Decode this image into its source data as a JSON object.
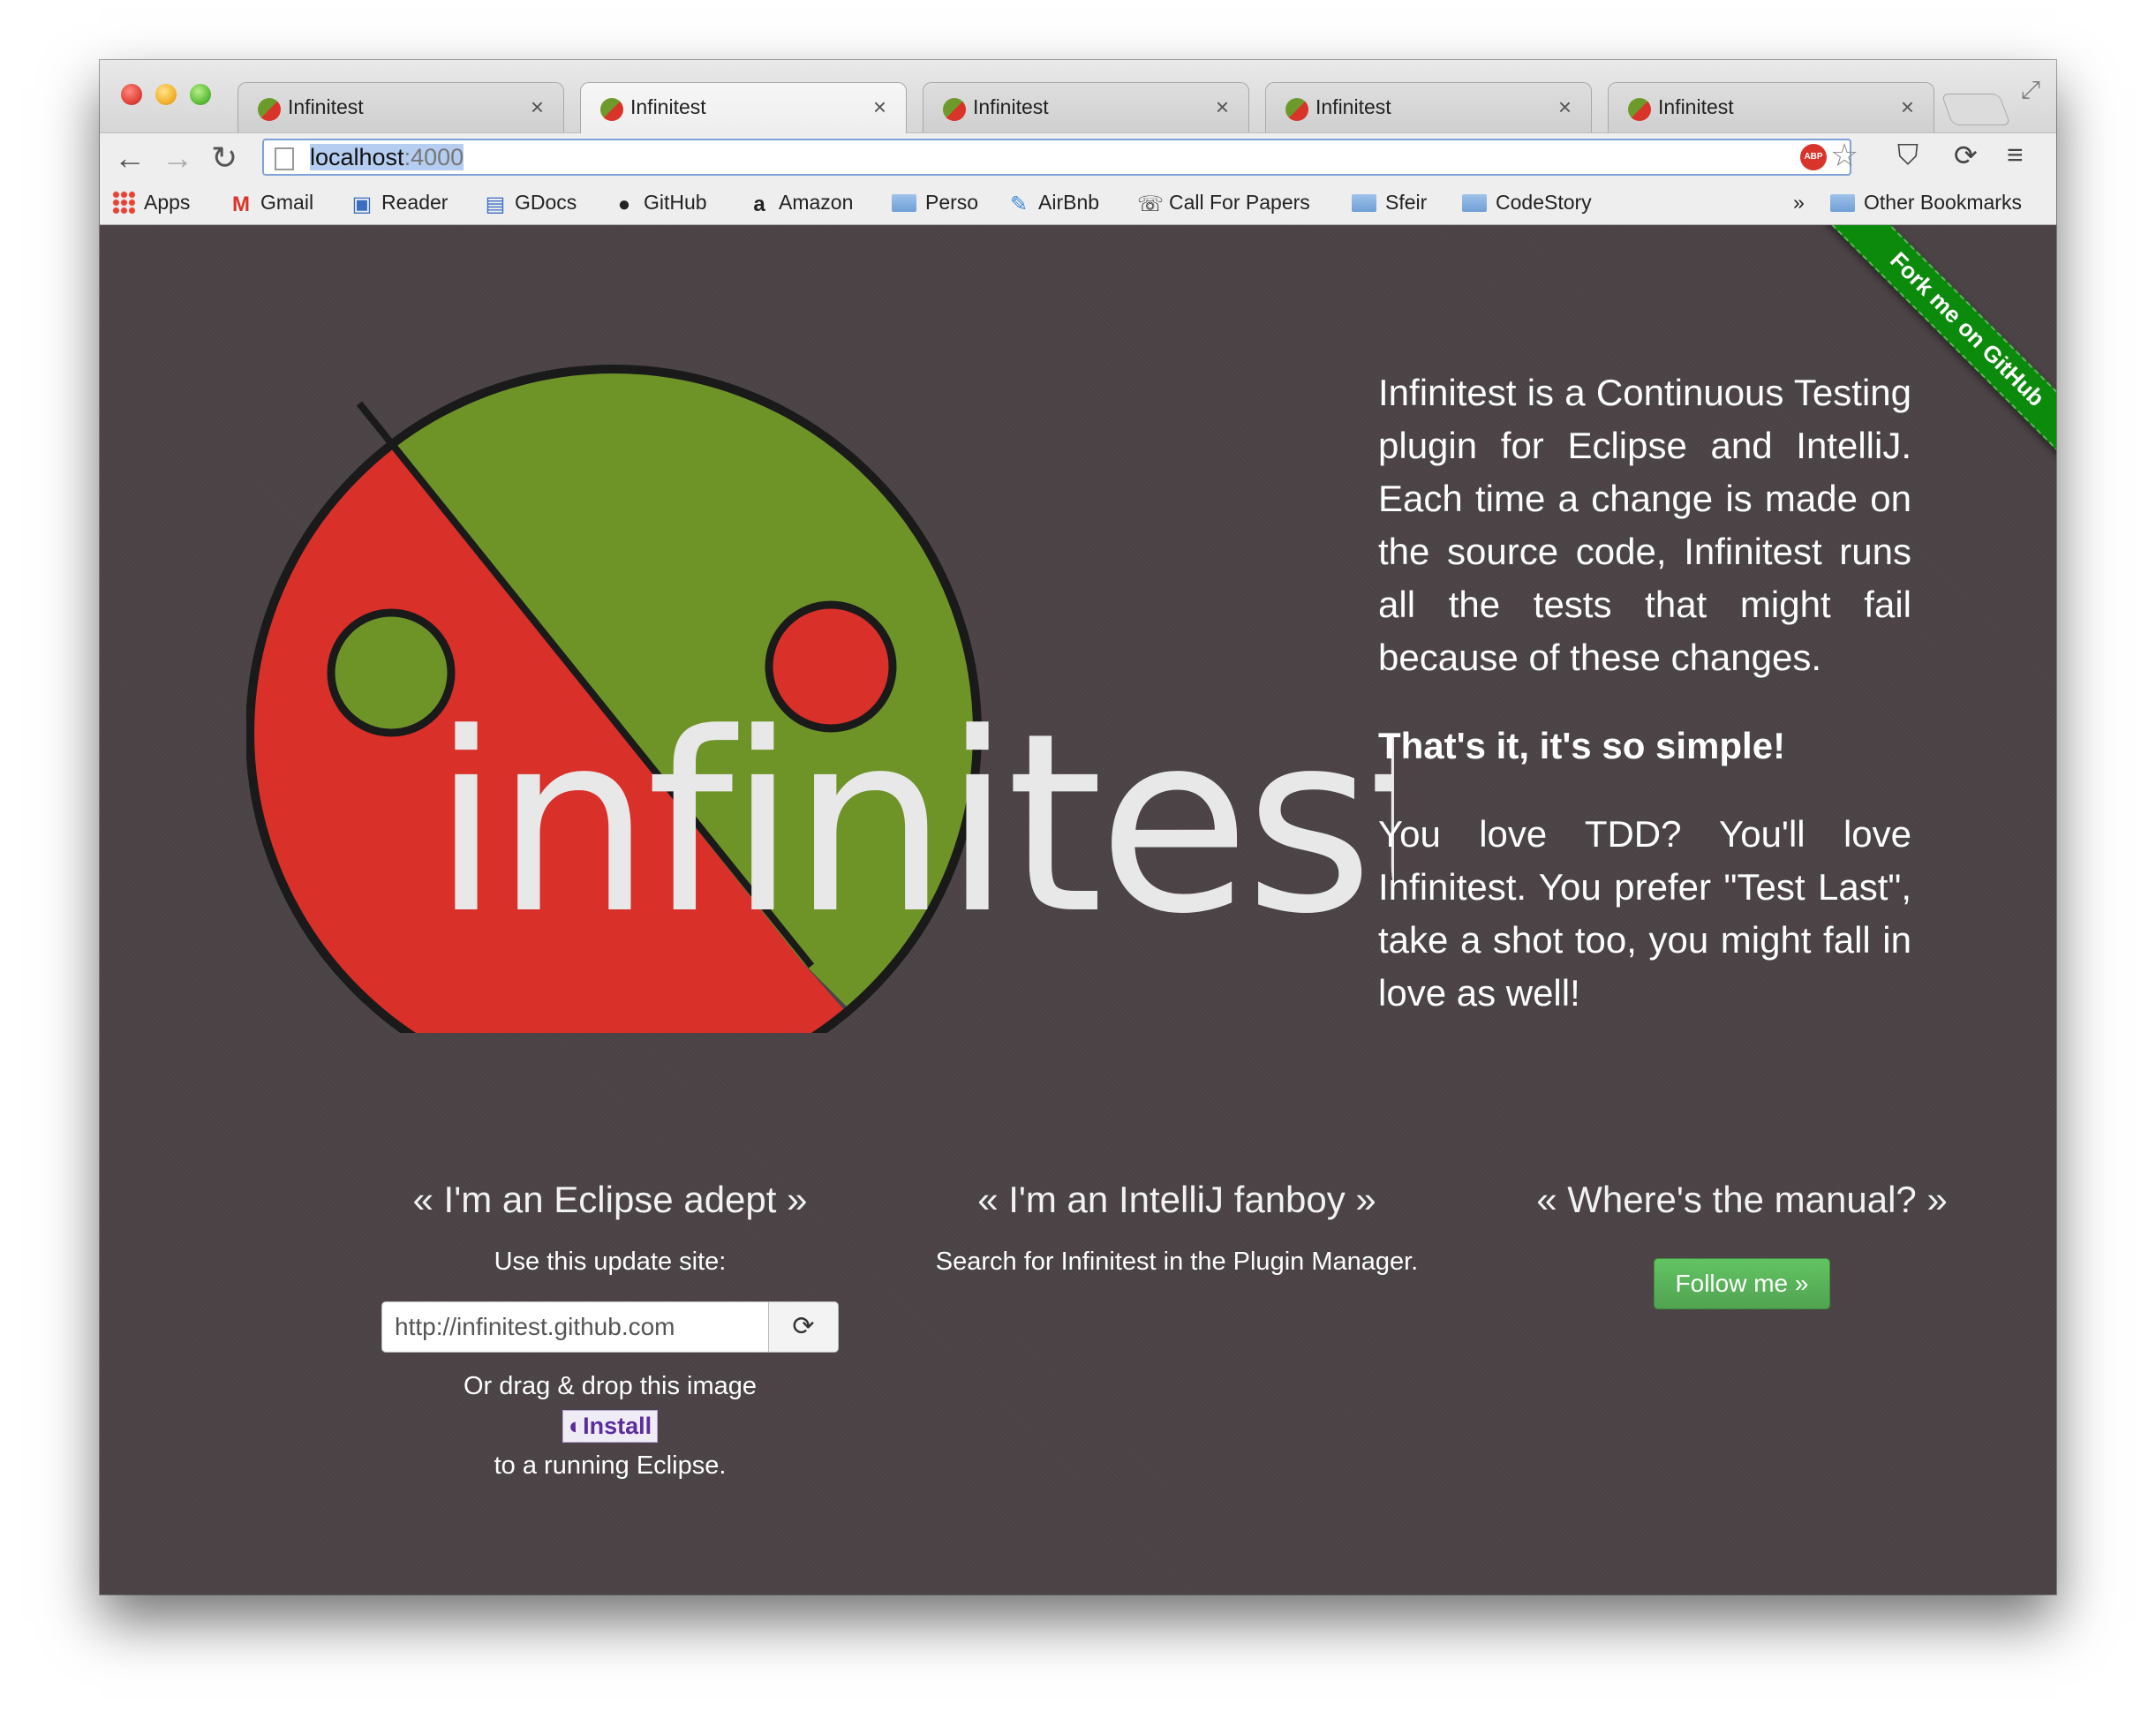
{
  "browser": {
    "tabs": [
      {
        "title": "Infinitest"
      },
      {
        "title": "Infinitest"
      },
      {
        "title": "Infinitest"
      },
      {
        "title": "Infinitest"
      },
      {
        "title": "Infinitest"
      }
    ],
    "close_glyph": "×",
    "address": {
      "host": "localhost",
      "port": ":4000"
    },
    "abp_label": "ABP",
    "bookmarks": [
      {
        "label": "Apps",
        "icon": "apps-grid-icon"
      },
      {
        "label": "Gmail",
        "icon": "gmail-icon"
      },
      {
        "label": "Reader",
        "icon": "reader-icon"
      },
      {
        "label": "GDocs",
        "icon": "gdocs-icon"
      },
      {
        "label": "GitHub",
        "icon": "github-icon"
      },
      {
        "label": "Amazon",
        "icon": "amazon-icon"
      },
      {
        "label": "Perso",
        "icon": "folder-icon"
      },
      {
        "label": "AirBnb",
        "icon": "airbnb-icon"
      },
      {
        "label": "Call For Papers",
        "icon": "call-for-papers-icon"
      },
      {
        "label": "Sfeir",
        "icon": "folder-icon"
      },
      {
        "label": "CodeStory",
        "icon": "folder-icon"
      }
    ],
    "more_bookmarks": "»",
    "other_bookmarks": "Other Bookmarks"
  },
  "page": {
    "logo_word": "infinitest",
    "ribbon": "Fork me on GitHub",
    "intro_p1": "Infinitest is a Continuous Testing plugin for Eclipse and IntelliJ. Each time a change is made on the source code, Infinitest runs all the tests that might fail because of these changes.",
    "intro_p2": "That's it, it's so simple!",
    "intro_p3": "You love TDD? You'll love Infinitest. You prefer \"Test Last\", take a shot too, you might fall in love as well!",
    "eclipse": {
      "heading": "« I'm an Eclipse adept »",
      "update_label": "Use this update site:",
      "update_url": "http://infinitest.github.com",
      "drag_text": "Or drag & drop this image",
      "install_label": "Install",
      "running_text": "to a running Eclipse."
    },
    "intellij": {
      "heading": "« I'm an IntelliJ fanboy »",
      "text": "Search for Infinitest in the Plugin Manager."
    },
    "manual": {
      "heading": "« Where's the manual? »",
      "button": "Follow me »"
    }
  },
  "colors": {
    "background": "#4a4244",
    "logo_green": "#6e9428",
    "logo_red": "#d9302a",
    "ribbon_green": "#0b8a0b",
    "button_green": "#5bb75b"
  }
}
